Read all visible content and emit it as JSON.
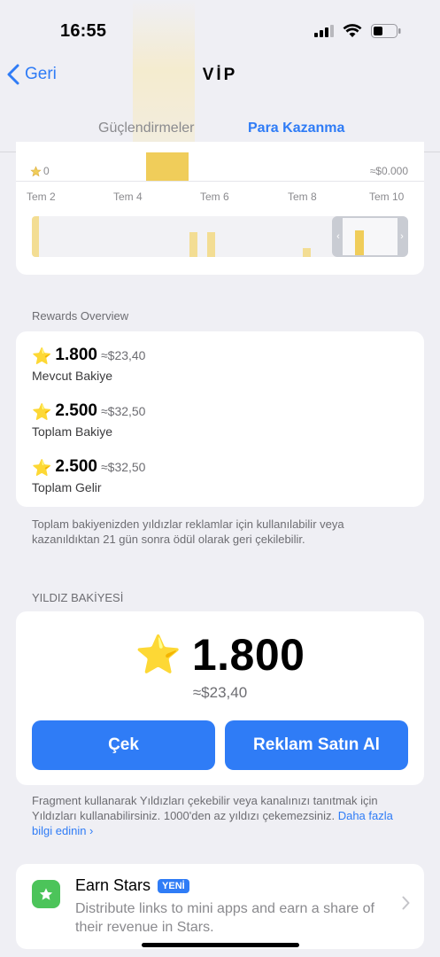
{
  "status_bar": {
    "time": "16:55"
  },
  "nav": {
    "back_label": "Geri",
    "title": "VİP"
  },
  "tabs": [
    {
      "label": "Güçlendirmeler",
      "active": false
    },
    {
      "label": "Para Kazanma",
      "active": true
    }
  ],
  "chart_data": {
    "type": "bar",
    "y_left_label": "0",
    "y_right_label": "≈$0.000",
    "x_ticks": [
      "Tem 2",
      "Tem 4",
      "Tem 6",
      "Tem 8",
      "Tem 10"
    ],
    "accent_color": "#f0cd5a"
  },
  "rewards_overview": {
    "header": "Rewards Overview",
    "items": [
      {
        "value": "1.800",
        "usd": "≈$23,40",
        "label": "Mevcut Bakiye"
      },
      {
        "value": "2.500",
        "usd": "≈$32,50",
        "label": "Toplam Bakiye"
      },
      {
        "value": "2.500",
        "usd": "≈$32,50",
        "label": "Toplam Gelir"
      }
    ],
    "footnote": "Toplam bakiyenizden yıldızlar reklamlar için kullanılabilir veya kazanıldıktan 21 gün sonra ödül olarak geri çekilebilir."
  },
  "star_balance": {
    "header": "YILDIZ BAKİYESİ",
    "value": "1.800",
    "usd": "≈$23,40",
    "withdraw_label": "Çek",
    "buy_ads_label": "Reklam Satın Al",
    "footnote": "Fragment kullanarak Yıldızları çekebilir veya kanalınızı tanıtmak için Yıldızları kullanabilirsiniz. 1000'den az yıldızı çekemezsiniz. ",
    "learn_more": "Daha fazla bilgi edinin"
  },
  "earn_stars": {
    "title": "Earn Stars",
    "badge": "YENİ",
    "description": "Distribute links to mini apps and earn a share of their revenue in Stars."
  },
  "colors": {
    "accent": "#2f7cf6",
    "star": "#f0cd5a",
    "earn_icon": "#4cc45a"
  },
  "icons": [
    "back-chevron-icon",
    "star-icon",
    "signal-icon",
    "wifi-icon",
    "battery-icon",
    "chevron-right-icon",
    "earn-stars-icon"
  ]
}
